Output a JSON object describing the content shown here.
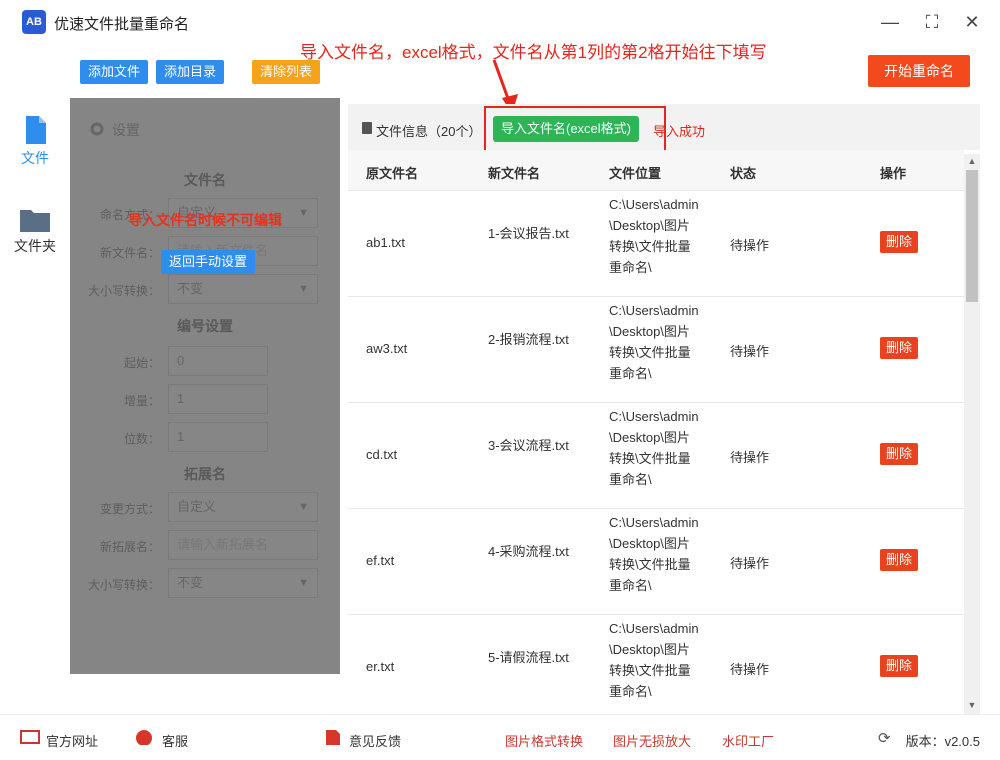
{
  "app": {
    "logo": "AB",
    "title": "优速文件批量重命名"
  },
  "window": {
    "minimize": "—",
    "maximize": "⛶",
    "close": "✕"
  },
  "toolbar": {
    "add_file": "添加文件",
    "add_dir": "添加目录",
    "clear": "清除列表",
    "start": "开始重命名"
  },
  "annotation": {
    "text": "导入文件名，excel格式，文件名从第1列的第2格开始往下填写"
  },
  "leftnav": {
    "files": "文件",
    "folders": "文件夹"
  },
  "settings": {
    "header": "设置",
    "filename_section": "文件名",
    "naming_label": "命名方式：",
    "naming_value": "自定义",
    "newname_label": "新文件名：",
    "newname_placeholder": "请输入新文件名",
    "case_label": "大小写转换：",
    "case_value": "不变",
    "numbering_section": "编号设置",
    "start_label": "起始：",
    "start_value": "0",
    "step_label": "增量：",
    "step_value": "1",
    "digits_label": "位数：",
    "digits_value": "1",
    "ext_section": "拓展名",
    "ext_mode_label": "变更方式：",
    "ext_mode_value": "自定义",
    "new_ext_label": "新拓展名：",
    "new_ext_placeholder": "请输入新拓展名",
    "ext_case_label": "大小写转换：",
    "ext_case_value": "不变",
    "warning": "导入文件名时候不可编辑",
    "back_button": "返回手动设置"
  },
  "files": {
    "info_label": "文件信息（20个）",
    "import_button": "导入文件名(excel格式)",
    "import_status": "导入成功",
    "columns": [
      "原文件名",
      "新文件名",
      "文件位置",
      "状态",
      "操作"
    ],
    "rows": [
      {
        "orig": "ab1.txt",
        "new": "1-会议报告.txt",
        "path": "C:\\Users\\admin\\Desktop\\图片转换\\文件批量重命名\\",
        "status": "待操作",
        "action": "删除"
      },
      {
        "orig": "aw3.txt",
        "new": "2-报销流程.txt",
        "path": "C:\\Users\\admin\\Desktop\\图片转换\\文件批量重命名\\",
        "status": "待操作",
        "action": "删除"
      },
      {
        "orig": "cd.txt",
        "new": "3-会议流程.txt",
        "path": "C:\\Users\\admin\\Desktop\\图片转换\\文件批量重命名\\",
        "status": "待操作",
        "action": "删除"
      },
      {
        "orig": "ef.txt",
        "new": "4-采购流程.txt",
        "path": "C:\\Users\\admin\\Desktop\\图片转换\\文件批量重命名\\",
        "status": "待操作",
        "action": "删除"
      },
      {
        "orig": "er.txt",
        "new": "5-请假流程.txt",
        "path": "C:\\Users\\admin\\Desktop\\图片转换\\文件批量重命名\\",
        "status": "待操作",
        "action": "删除"
      }
    ]
  },
  "footer": {
    "website": "官方网址",
    "service": "客服",
    "feedback": "意见反馈",
    "img_convert": "图片格式转换",
    "img_enlarge": "图片无损放大",
    "watermark": "水印工厂",
    "version": "版本：v2.0.5"
  },
  "colors": {
    "primary": "#2e8ded",
    "orange": "#f7a21b",
    "danger": "#f24a1d",
    "success": "#2db456",
    "annot": "#e5261c"
  }
}
